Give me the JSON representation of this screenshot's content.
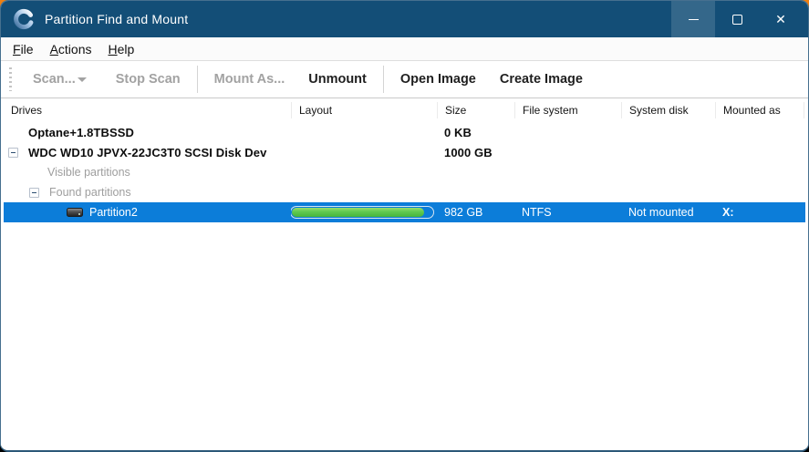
{
  "window": {
    "title": "Partition Find and Mount",
    "icons": [
      "app-logo-spinner",
      "minimize-icon",
      "maximize-icon",
      "close-icon"
    ],
    "close_glyph": "✕"
  },
  "colors": {
    "titlebar_bg": "#134e77",
    "selection_bg": "#0c7dd9",
    "progress_green": "#46b43c",
    "desktop_orange": "#ef8011",
    "muted_text": "#9e9e9e",
    "disabled_text": "#a2a2a2"
  },
  "menu": {
    "items": [
      {
        "label": "File"
      },
      {
        "label": "Actions"
      },
      {
        "label": "Help"
      }
    ]
  },
  "toolbar": {
    "buttons": [
      {
        "label": "Scan...",
        "enabled": false,
        "has_dropdown": true
      },
      {
        "label": "Stop Scan",
        "enabled": false
      },
      {
        "label": "Mount As...",
        "enabled": false
      },
      {
        "label": "Unmount",
        "enabled": true
      },
      {
        "label": "Open Image",
        "enabled": true
      },
      {
        "label": "Create Image",
        "enabled": true
      }
    ]
  },
  "table": {
    "columns": [
      "Drives",
      "Layout",
      "Size",
      "File system",
      "System disk",
      "Mounted as"
    ],
    "rows": [
      {
        "drive": "Optane+1.8TBSSD",
        "size": "0 KB",
        "bold": true
      },
      {
        "drive": "WDC WD10 JPVX-22JC3T0 SCSI Disk Dev",
        "size": "1000 GB",
        "bold": true,
        "expanded": true
      },
      {
        "drive": "Visible partitions",
        "muted": true
      },
      {
        "drive": "Found partitions",
        "muted": true,
        "expanded": true
      },
      {
        "drive": "Partition2",
        "size": "982 GB",
        "file_system": "NTFS",
        "system_disk": "Not mounted",
        "mounted_as": "X:",
        "selected": true,
        "layout_used_pct": 94
      }
    ]
  }
}
